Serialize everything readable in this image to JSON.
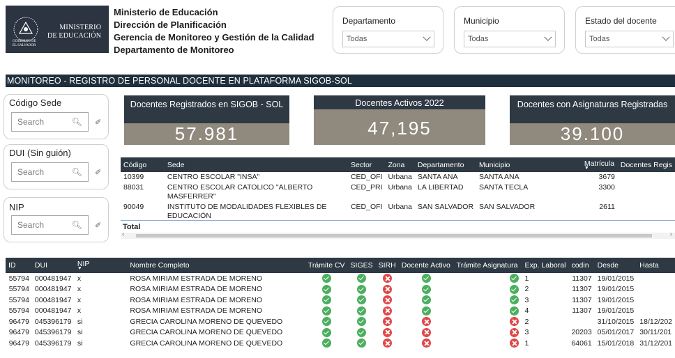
{
  "logo": {
    "top_text": "MINISTERIO",
    "bottom_text": "DE EDUCACIÓN",
    "gov_line1": "GOBIERNO DE",
    "gov_line2": "EL SALVADOR"
  },
  "header": [
    "Ministerio de Educación",
    "Dirección de Planificación",
    "Gerencia de Monitoreo y Gestión de la Calidad",
    "Departamento de Monitoreo"
  ],
  "filters": [
    {
      "label": "Departamento",
      "value": "Todas"
    },
    {
      "label": "Municipio",
      "value": "Todas"
    },
    {
      "label": "Estado del docente",
      "value": "Todas"
    }
  ],
  "title": "MONITOREO - REGISTRO DE PERSONAL DOCENTE EN PLATAFORMA SIGOB-SOL",
  "slicers": [
    {
      "label": "Código Sede",
      "placeholder": "Search"
    },
    {
      "label": "DUI (Sin guión)",
      "placeholder": "Search"
    },
    {
      "label": "NIP",
      "placeholder": "Search"
    }
  ],
  "kpis": [
    {
      "label": "Docentes Registrados en SIGOB - SOL",
      "value": "57.981"
    },
    {
      "label": "Docentes Activos 2022",
      "value": "47,195"
    },
    {
      "label": "Docentes con Asignaturas Registradas",
      "value": "39.100"
    }
  ],
  "sede_table": {
    "columns": [
      "Código",
      "Sede",
      "Sector",
      "Zona",
      "Departamento",
      "Municipio",
      "Matrícula",
      "Docentes Regis"
    ],
    "rows": [
      [
        "10399",
        "CENTRO ESCOLAR \"INSA\"",
        "CED_OFI",
        "Urbana",
        "SANTA ANA",
        "SANTA ANA",
        "3679",
        ""
      ],
      [
        "88031",
        "CENTRO ESCOLAR CATOLICO \"ALBERTO MASFERRER\"",
        "CED_PRI",
        "Urbana",
        "LA LIBERTAD",
        "SANTA TECLA",
        "3300",
        ""
      ],
      [
        "90049",
        "INSTITUTO DE MODALIDADES FLEXIBLES DE EDUCACIÓN",
        "CED_OFI",
        "Urbana",
        "SAN SALVADOR",
        "SAN SALVADOR",
        "2611",
        ""
      ]
    ],
    "total_label": "Total"
  },
  "docente_table": {
    "columns": [
      "ID",
      "DUI",
      "NIP",
      "Nombre Completo",
      "Trámite CV",
      "SIGES",
      "SIRH",
      "Docente Activo",
      "Trámite Asignatura",
      "Exp. Laboral",
      "codin",
      "Desde",
      "Hasta"
    ],
    "rows": [
      [
        "55794",
        "000481947",
        "x",
        "ROSA MIRIAM ESTRADA DE MORENO",
        "ok",
        "ok",
        "no",
        "ok",
        "ok",
        "1",
        "11307",
        "19/01/2015",
        ""
      ],
      [
        "55794",
        "000481947",
        "x",
        "ROSA MIRIAM ESTRADA DE MORENO",
        "ok",
        "ok",
        "no",
        "ok",
        "ok",
        "2",
        "11307",
        "19/01/2015",
        ""
      ],
      [
        "55794",
        "000481947",
        "x",
        "ROSA MIRIAM ESTRADA DE MORENO",
        "ok",
        "ok",
        "no",
        "ok",
        "ok",
        "3",
        "11307",
        "19/01/2015",
        ""
      ],
      [
        "55794",
        "000481947",
        "x",
        "ROSA MIRIAM ESTRADA DE MORENO",
        "ok",
        "ok",
        "no",
        "ok",
        "ok",
        "4",
        "11307",
        "19/01/2015",
        ""
      ],
      [
        "96479",
        "045396179",
        "si",
        "GRECIA CAROLINA MORENO DE QUEVEDO",
        "ok",
        "ok",
        "no",
        "no",
        "no",
        "2",
        "",
        "31/10/2015",
        "18/12/202"
      ],
      [
        "96479",
        "045396179",
        "si",
        "GRECIA CAROLINA MORENO DE QUEVEDO",
        "ok",
        "ok",
        "no",
        "no",
        "no",
        "3",
        "20203",
        "05/01/2017",
        "30/11/201"
      ],
      [
        "96479",
        "045396179",
        "si",
        "GRECIA CAROLINA MORENO DE QUEVEDO",
        "ok",
        "ok",
        "no",
        "no",
        "no",
        "1",
        "64061",
        "15/01/2018",
        "31/12/201"
      ]
    ]
  },
  "colors": {
    "header_dark": "#2e3944",
    "kpi_body": "#8f8a7d",
    "ok_green": "#4caf5f",
    "no_red": "#e04848"
  }
}
